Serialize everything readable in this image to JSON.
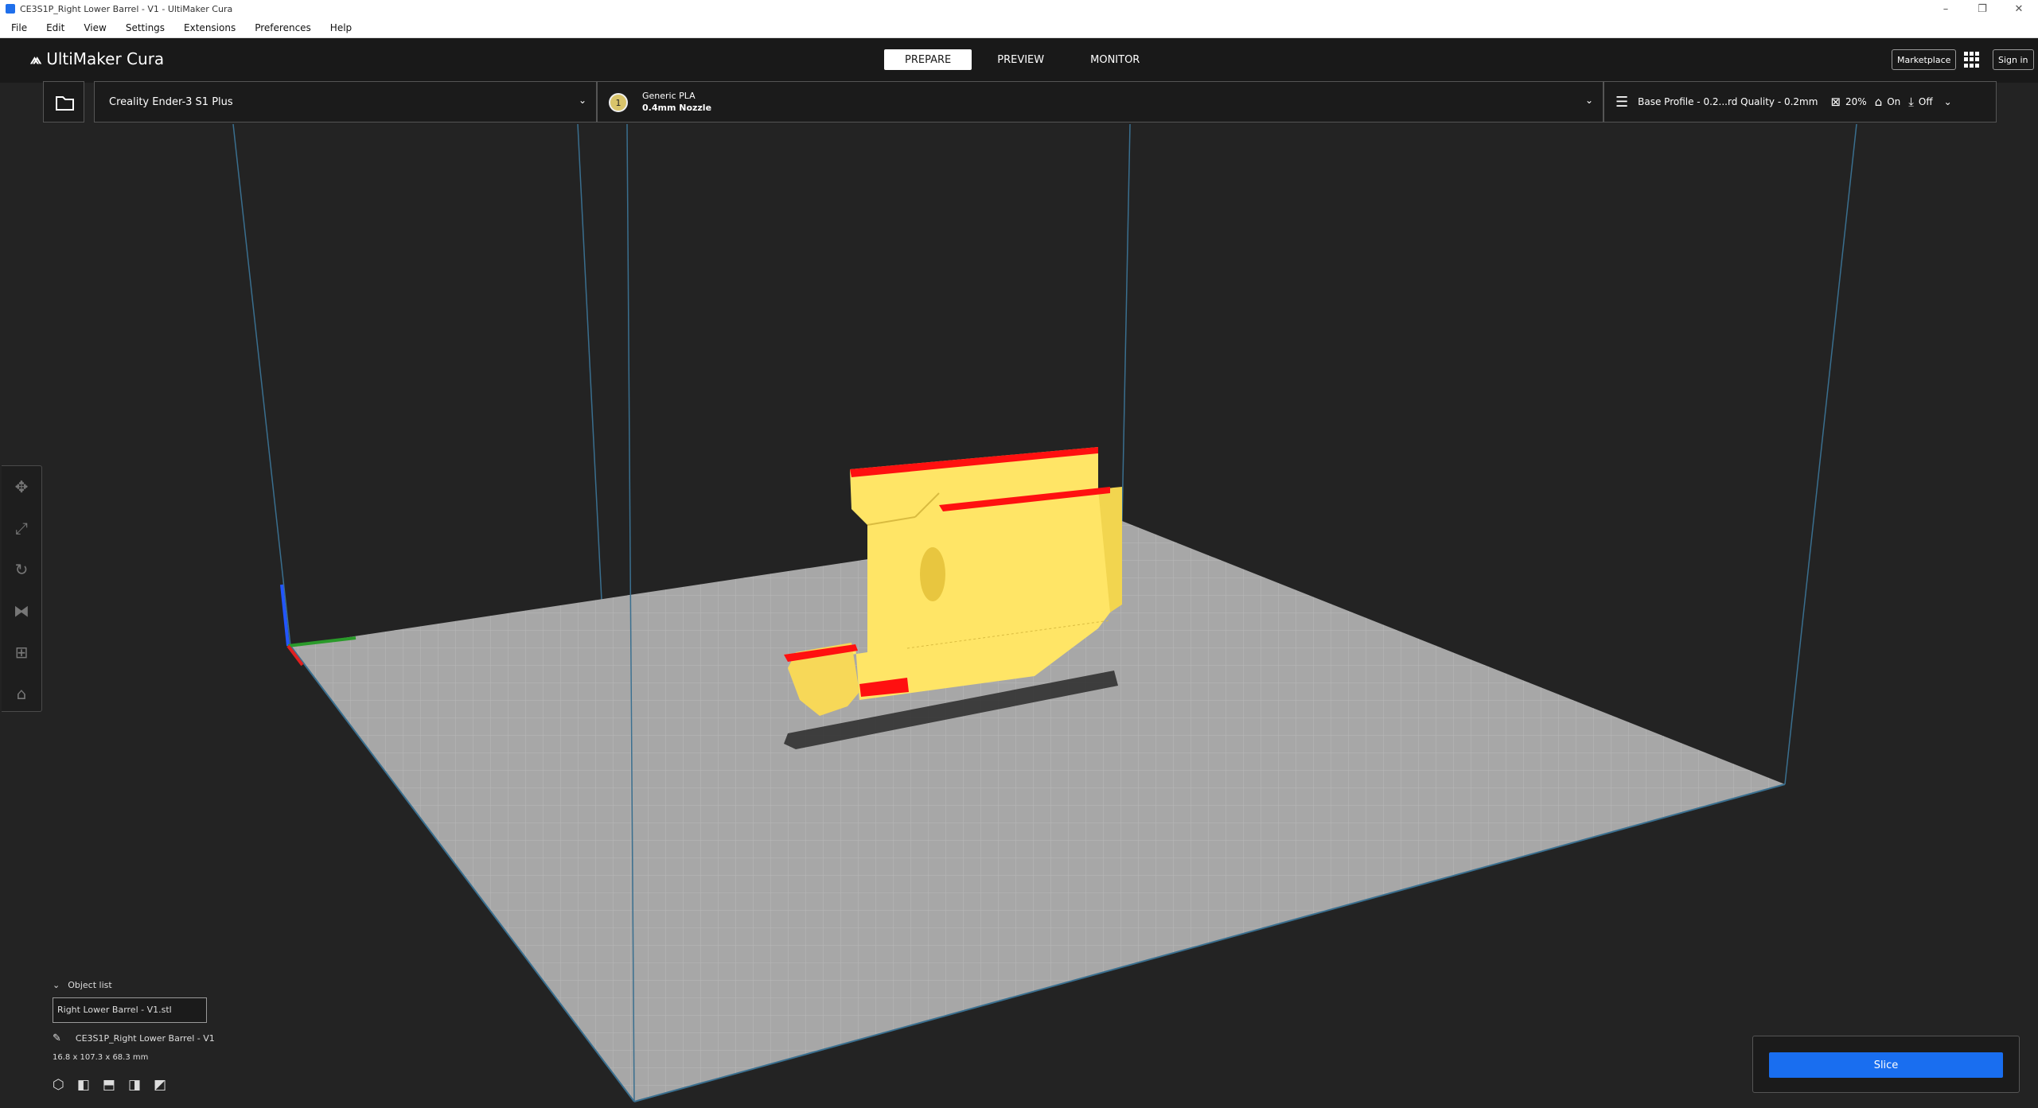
{
  "window": {
    "title": "CE3S1P_Right Lower Barrel - V1 - UltiMaker Cura"
  },
  "menu": [
    "File",
    "Edit",
    "View",
    "Settings",
    "Extensions",
    "Preferences",
    "Help"
  ],
  "header": {
    "logo": "UltiMaker Cura",
    "stages": [
      "PREPARE",
      "PREVIEW",
      "MONITOR"
    ],
    "active_stage": "PREPARE",
    "marketplace": "Marketplace",
    "sign_in": "Sign in"
  },
  "printer": {
    "name": "Creality Ender-3 S1 Plus"
  },
  "material": {
    "name": "Generic PLA",
    "nozzle": "0.4mm Nozzle",
    "extruder_index": "1"
  },
  "print_settings": {
    "profile": "Base Profile - 0.2...rd Quality - 0.2mm",
    "infill": "20%",
    "support": "On",
    "adhesion": "Off"
  },
  "object_list": {
    "header": "Object list",
    "selected_file": "Right Lower Barrel - V1.stl",
    "project_name": "CE3S1P_Right Lower Barrel - V1",
    "dimensions": "16.8 x 107.3 x 68.3 mm"
  },
  "slice": {
    "label": "Slice"
  },
  "colors": {
    "accent": "#196ef0",
    "model": "#ffe566",
    "overhang": "#ff0000",
    "bed": "#a9a9a9"
  },
  "icons": [
    "folder-icon",
    "chevron-down-icon",
    "settings-sliders-icon",
    "infill-icon",
    "support-icon",
    "adhesion-icon",
    "move-icon",
    "scale-icon",
    "rotate-icon",
    "mirror-icon",
    "per-model-settings-icon",
    "support-blocker-icon",
    "pencil-icon",
    "view-3d-icon",
    "view-front-icon",
    "view-top-icon",
    "view-left-icon",
    "view-right-icon"
  ]
}
